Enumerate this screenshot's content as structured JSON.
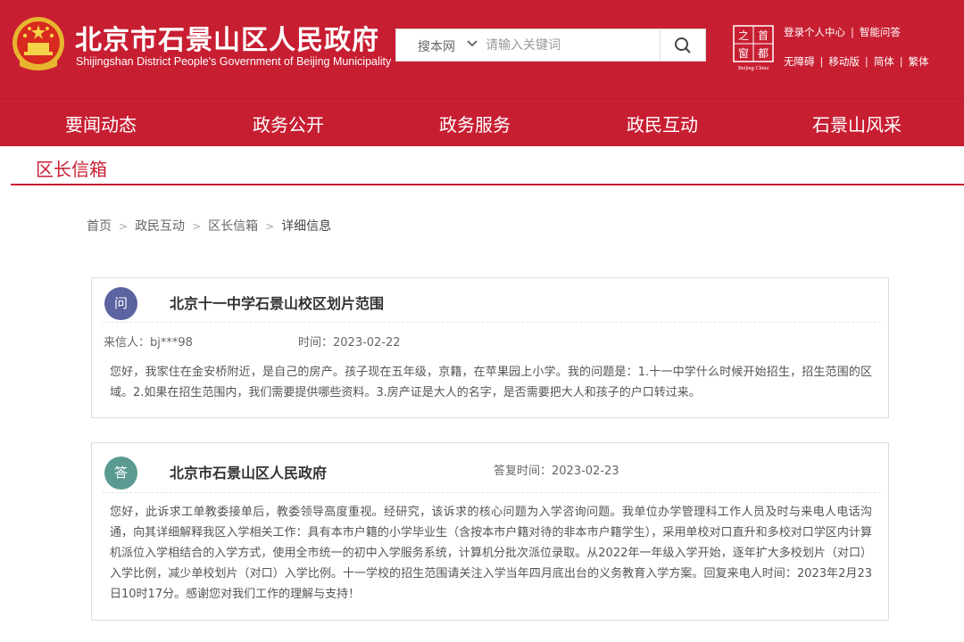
{
  "header": {
    "title": "北京市石景山区人民政府",
    "subtitle": "Shijingshan District People's Government of Beijing Municipality",
    "emblem_icon": "national-emblem-icon",
    "brand_color": "#c81e32"
  },
  "search": {
    "scope_label": "搜本网",
    "placeholder": "请输入关键词",
    "button_icon": "search-icon"
  },
  "capital_logo": {
    "icon": "capital-beijing-logo-icon",
    "chars": [
      "之",
      "首",
      "窗",
      "都"
    ],
    "caption": "Beijing·China"
  },
  "utility_links": {
    "row1": [
      "登录个人中心",
      "智能问答"
    ],
    "row2": [
      "无障碍",
      "移动版",
      "简体",
      "繁体"
    ]
  },
  "nav": {
    "items": [
      "要闻动态",
      "政务公开",
      "政务服务",
      "政民互动",
      "石景山风采"
    ]
  },
  "section": {
    "title": "区长信箱"
  },
  "breadcrumb": {
    "items": [
      "首页",
      "政民互动",
      "区长信箱"
    ],
    "current": "详细信息",
    "separator": ">"
  },
  "question": {
    "badge": "问",
    "title": "北京十一中学石景山校区划片范围",
    "sender": "来信人：bj***98",
    "time": "时间：2023-02-22",
    "body": "您好，我家住在金安桥附近，是自己的房产。孩子现在五年级，京籍，在苹果园上小学。我的问题是：1.十一中学什么时候开始招生，招生范围的区域。2.如果在招生范围内，我们需要提供哪些资料。3.房产证是大人的名字，是否需要把大人和孩子的户口转过来。"
  },
  "answer": {
    "badge": "答",
    "title": "北京市石景山区人民政府",
    "reply_time": "答复时间：2023-02-23",
    "body": "您好，此诉求工单教委接单后，教委领导高度重视。经研究，该诉求的核心问题为入学咨询问题。我单位办学管理科工作人员及时与来电人电话沟通，向其详细解释我区入学相关工作：具有本市户籍的小学毕业生（含按本市户籍对待的非本市户籍学生），采用单校对口直升和多校对口学区内计算机派位入学相结合的入学方式，使用全市统一的初中入学服务系统，计算机分批次派位录取。从2022年一年级入学开始，逐年扩大多校划片（对口）入学比例，减少单校划片（对口）入学比例。十一学校的招生范围请关注入学当年四月底出台的义务教育入学方案。回复来电人时间：2023年2月23日10时17分。感谢您对我们工作的理解与支持！"
  }
}
